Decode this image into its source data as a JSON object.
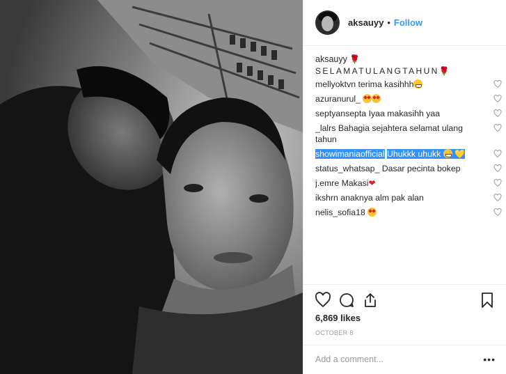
{
  "post": {
    "username": "aksauyy",
    "separator": "•",
    "follow_label": "Follow",
    "caption_user": "aksauyy",
    "caption_text": "SELAMATULANGTAHUN",
    "caption_emoji": "rose-icon"
  },
  "comments": [
    {
      "user": "mellyoktvn",
      "text": "terima kasihhh",
      "emoji": "grin-emoji"
    },
    {
      "user": "azuranurul_",
      "text": "",
      "emoji": "heart-eyes-emoji"
    },
    {
      "user": "septyansepta",
      "text": "Iyaa makasihh yaa",
      "emoji": ""
    },
    {
      "user": "_lalrs",
      "text": "Bahagia sejahtera selamat ulang tahun",
      "emoji": ""
    },
    {
      "user": "showimaniaofficial",
      "text": "Uhukkk uhukk",
      "emoji": "grin-yellow-heart"
    },
    {
      "user": "status_whatsap_",
      "text": "Dasar pecinta bokep",
      "emoji": ""
    },
    {
      "user": "j.emre",
      "text": "Makasi",
      "emoji": "red-heart"
    },
    {
      "user": "ikshrn",
      "text": "anaknya alm pak alan",
      "emoji": ""
    },
    {
      "user": "nelis_sofia18",
      "text": "",
      "emoji": "heart-eyes-emoji"
    }
  ],
  "actions": {
    "like_icon": "heart-outline-icon",
    "comment_icon": "comment-bubble-icon",
    "share_icon": "share-icon",
    "save_icon": "bookmark-icon",
    "likes_text": "6,869 likes",
    "date_text": "OCTOBER 8"
  },
  "add_comment": {
    "placeholder": "Add a comment...",
    "more_label": "•••"
  },
  "colors": {
    "accent": "#3897f0",
    "highlight": "#3390ff",
    "text": "#262626",
    "muted": "#999999",
    "border": "#efefef"
  }
}
